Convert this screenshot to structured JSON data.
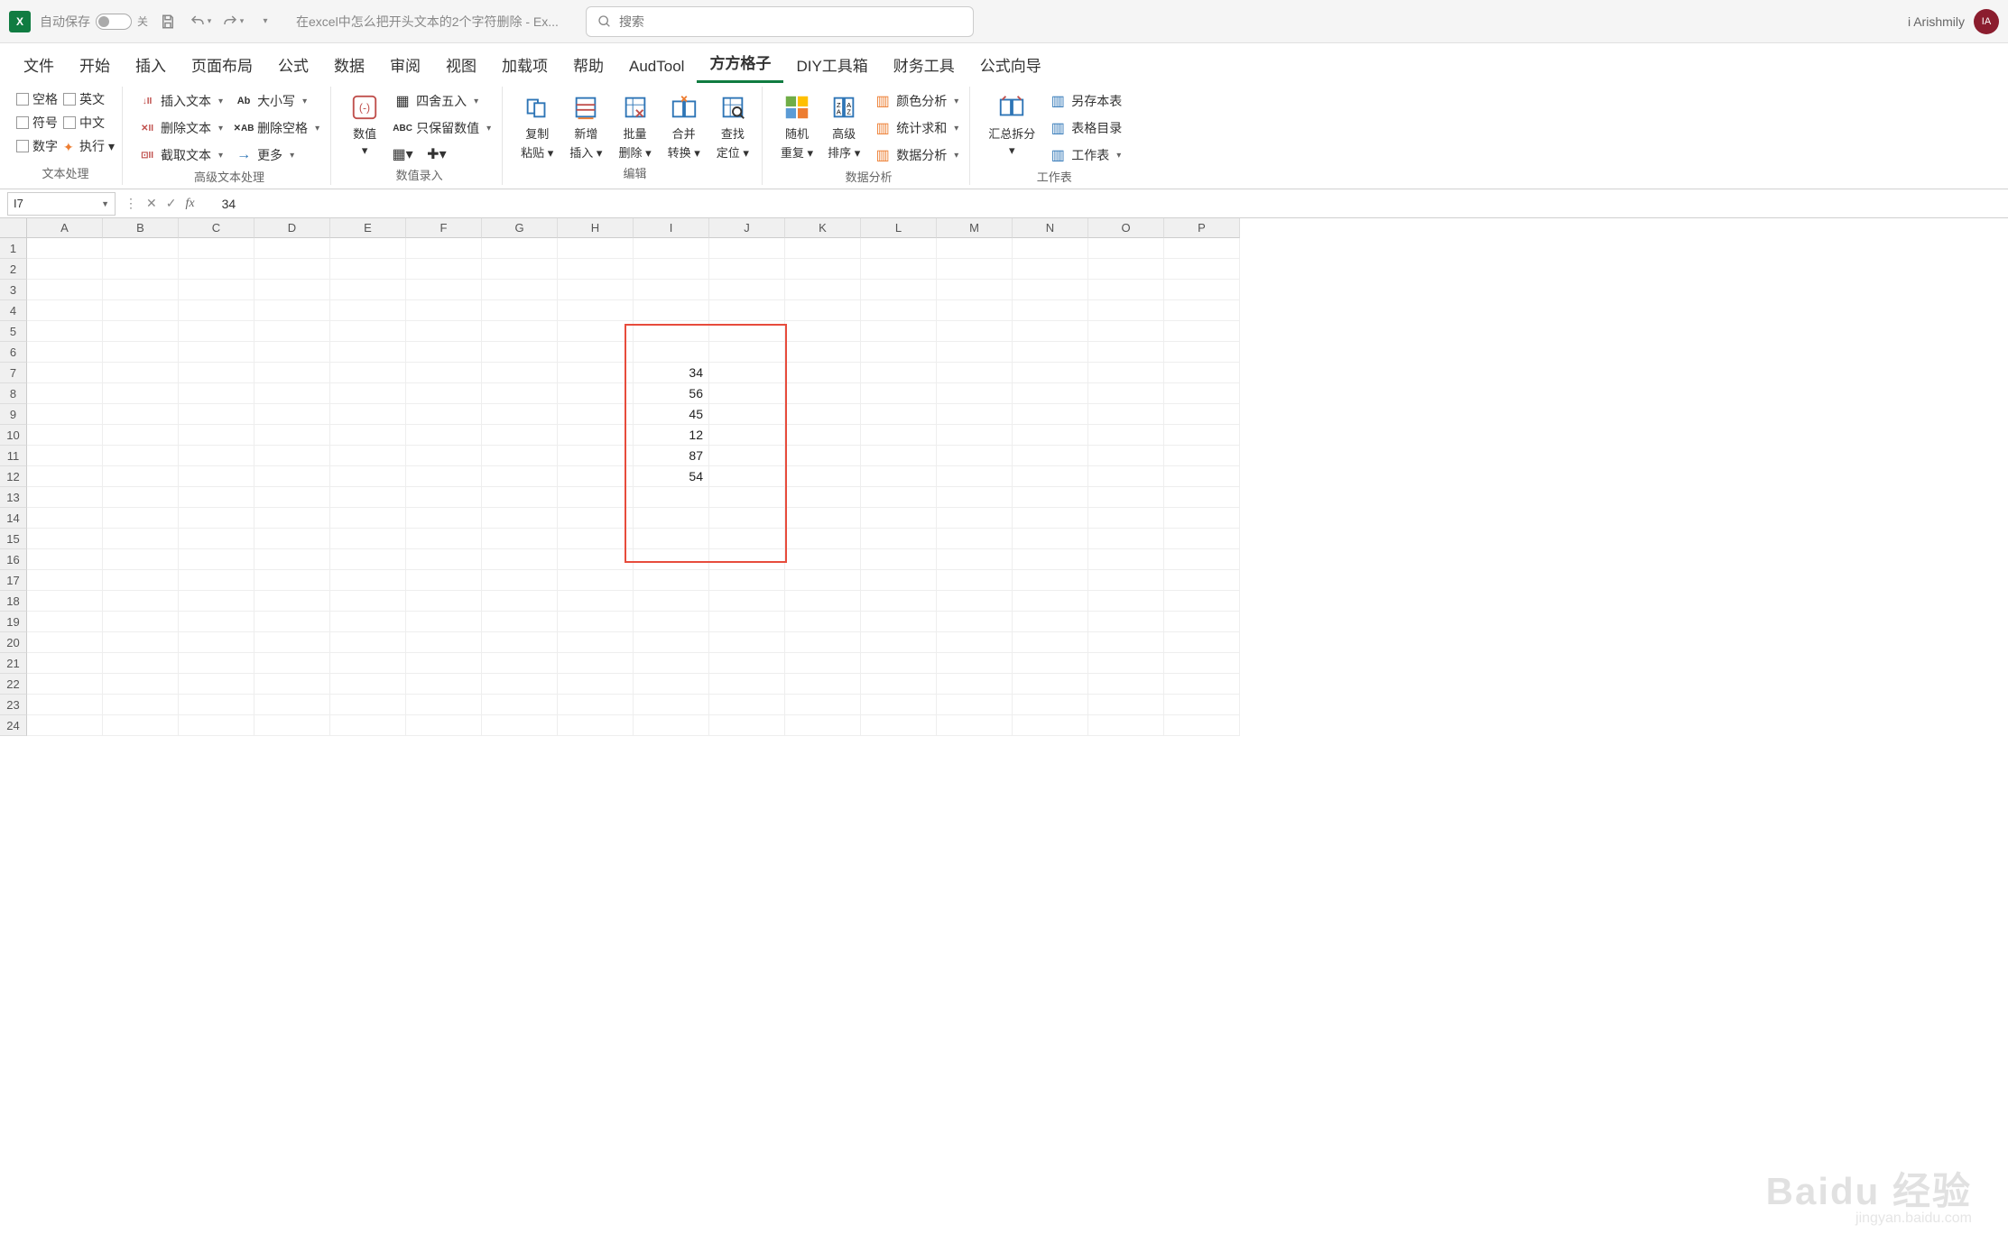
{
  "titlebar": {
    "autosave_label": "自动保存",
    "autosave_state": "关",
    "doc_title": "在excel中怎么把开头文本的2个字符删除  -  Ex...",
    "search_placeholder": "搜索",
    "user_name": "i Arishmily",
    "user_initials": "IA"
  },
  "tabs": [
    "文件",
    "开始",
    "插入",
    "页面布局",
    "公式",
    "数据",
    "审阅",
    "视图",
    "加载项",
    "帮助",
    "AudTool",
    "方方格子",
    "DIY工具箱",
    "财务工具",
    "公式向导"
  ],
  "active_tab_index": 11,
  "ribbon": {
    "group1": {
      "label": "文本处理",
      "checks": [
        [
          "空格",
          "英文"
        ],
        [
          "符号",
          "中文"
        ],
        [
          "数字",
          "执行"
        ]
      ]
    },
    "group2": {
      "label": "高级文本处理",
      "col1": [
        "插入文本",
        "删除文本",
        "截取文本"
      ],
      "col2": [
        "大小写",
        "删除空格",
        "更多"
      ]
    },
    "group3": {
      "label": "数值录入",
      "big": "数值",
      "items": [
        "四舍五入",
        "只保留数值"
      ]
    },
    "group4": {
      "label": "编辑",
      "bigs": [
        "复制粘贴",
        "新增插入",
        "批量删除",
        "合并转换",
        "查找定位"
      ]
    },
    "group5": {
      "label": "数据分析",
      "bigs": [
        "随机重复",
        "高级排序"
      ],
      "items": [
        "颜色分析",
        "统计求和",
        "数据分析"
      ]
    },
    "group6": {
      "label": "工作表",
      "big": "汇总拆分",
      "items": [
        "另存本表",
        "表格目录",
        "工作表"
      ]
    }
  },
  "formula_bar": {
    "name": "I7",
    "value": "34"
  },
  "columns": [
    "A",
    "B",
    "C",
    "D",
    "E",
    "F",
    "G",
    "H",
    "I",
    "J",
    "K",
    "L",
    "M",
    "N",
    "O",
    "P"
  ],
  "rows": 24,
  "cell_data": {
    "I7": "34",
    "I8": "56",
    "I9": "45",
    "I10": "12",
    "I11": "87",
    "I12": "54"
  },
  "red_box": {
    "col_start": 8,
    "row_start": 5,
    "col_span": 2,
    "row_span": 12
  },
  "watermark": "Baidu 经验",
  "watermark_sub": "jingyan.baidu.com"
}
